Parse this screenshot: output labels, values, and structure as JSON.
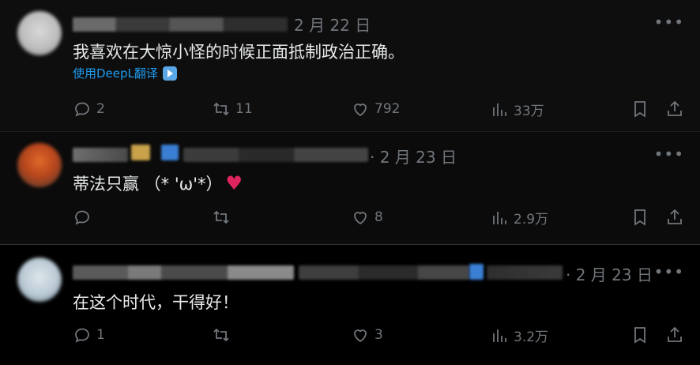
{
  "colors": {
    "background": "#000000",
    "text": "#e7e9ea",
    "muted": "#71767b",
    "link": "#1d9bf0",
    "heart": "#e0245e"
  },
  "tweets": [
    {
      "date": "2 月 22 日",
      "text": "我喜欢在大惊小怪的时候正面抵制政治正确。",
      "translate": "使用DeepL翻译",
      "more": "•••",
      "reply_count": "2",
      "retweet_count": "11",
      "like_count": "792",
      "view_count": "33万"
    },
    {
      "date": "· 2 月 23 日",
      "text": "蒂法只赢 （* 'ω'*）",
      "emoji": "♥",
      "more": "•••",
      "reply_count": "",
      "retweet_count": "",
      "like_count": "8",
      "view_count": "2.9万"
    },
    {
      "date": "· 2 月 23 日",
      "text": "在这个时代，干得好！",
      "more": "•••",
      "reply_count": "1",
      "retweet_count": "",
      "like_count": "3",
      "view_count": "3.2万"
    }
  ]
}
